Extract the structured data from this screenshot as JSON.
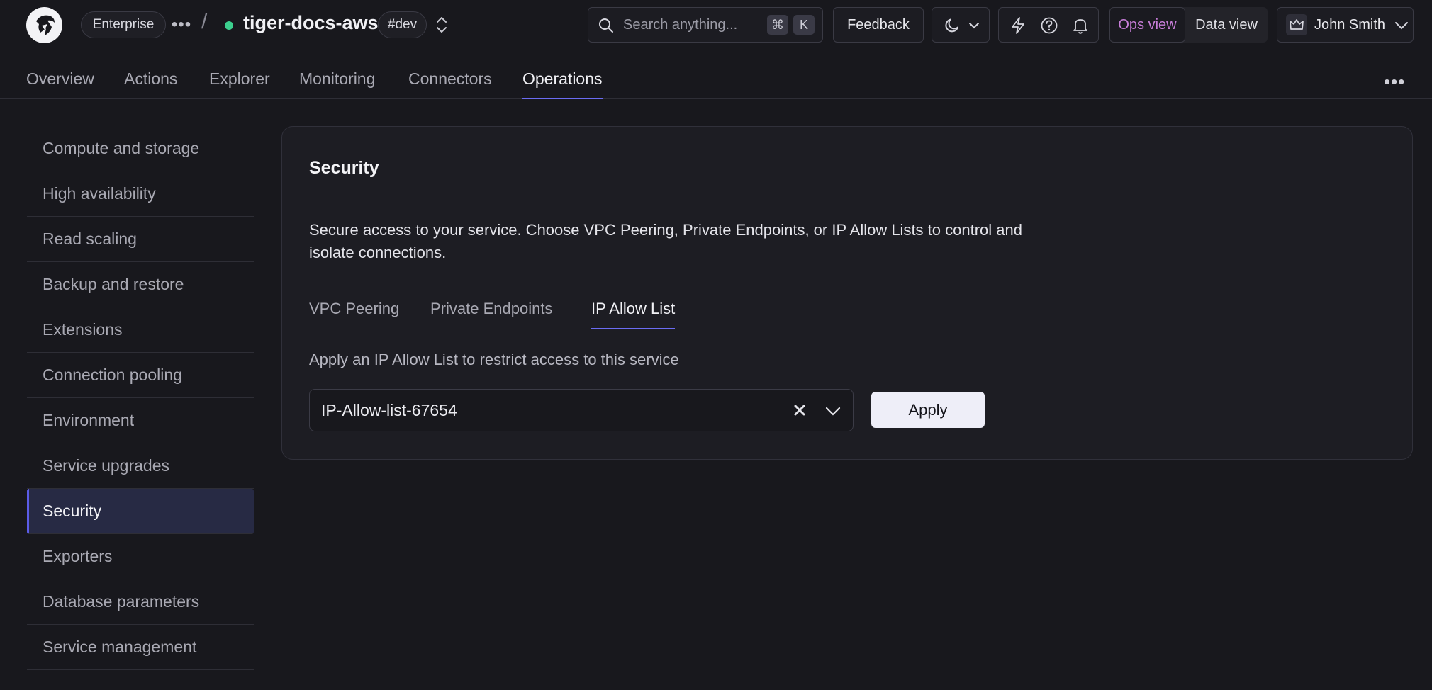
{
  "header": {
    "org_label": "Enterprise",
    "service_name": "tiger-docs-aws",
    "env_tag": "#dev",
    "search_placeholder": "Search anything...",
    "search_shortcut_mod": "⌘",
    "search_shortcut_key": "K",
    "feedback_label": "Feedback",
    "ops_view_label": "Ops view",
    "data_view_label": "Data view",
    "user_name": "John Smith",
    "status_color": "#3ccf8e"
  },
  "nav": {
    "tabs": [
      {
        "label": "Overview"
      },
      {
        "label": "Actions"
      },
      {
        "label": "Explorer"
      },
      {
        "label": "Monitoring"
      },
      {
        "label": "Connectors"
      },
      {
        "label": "Operations"
      }
    ],
    "active": "Operations"
  },
  "sidebar": {
    "items": [
      {
        "label": "Compute and storage"
      },
      {
        "label": "High availability"
      },
      {
        "label": "Read scaling"
      },
      {
        "label": "Backup and restore"
      },
      {
        "label": "Extensions"
      },
      {
        "label": "Connection pooling"
      },
      {
        "label": "Environment"
      },
      {
        "label": "Service upgrades"
      },
      {
        "label": "Security"
      },
      {
        "label": "Exporters"
      },
      {
        "label": "Database parameters"
      },
      {
        "label": "Service management"
      }
    ],
    "active": "Security"
  },
  "security": {
    "title": "Security",
    "description": "Secure access to your service. Choose VPC Peering, Private Endpoints, or IP Allow Lists to control and isolate connections.",
    "tabs": [
      {
        "label": "VPC Peering"
      },
      {
        "label": "Private Endpoints"
      },
      {
        "label": "IP Allow List"
      }
    ],
    "active_tab": "IP Allow List",
    "apply_hint": "Apply an IP Allow List to restrict access to this service",
    "selected_list": "IP-Allow-list-67654",
    "apply_label": "Apply"
  },
  "colors": {
    "accent": "#6b6cf2",
    "ops_view": "#c77dd8",
    "background": "#18181d"
  }
}
